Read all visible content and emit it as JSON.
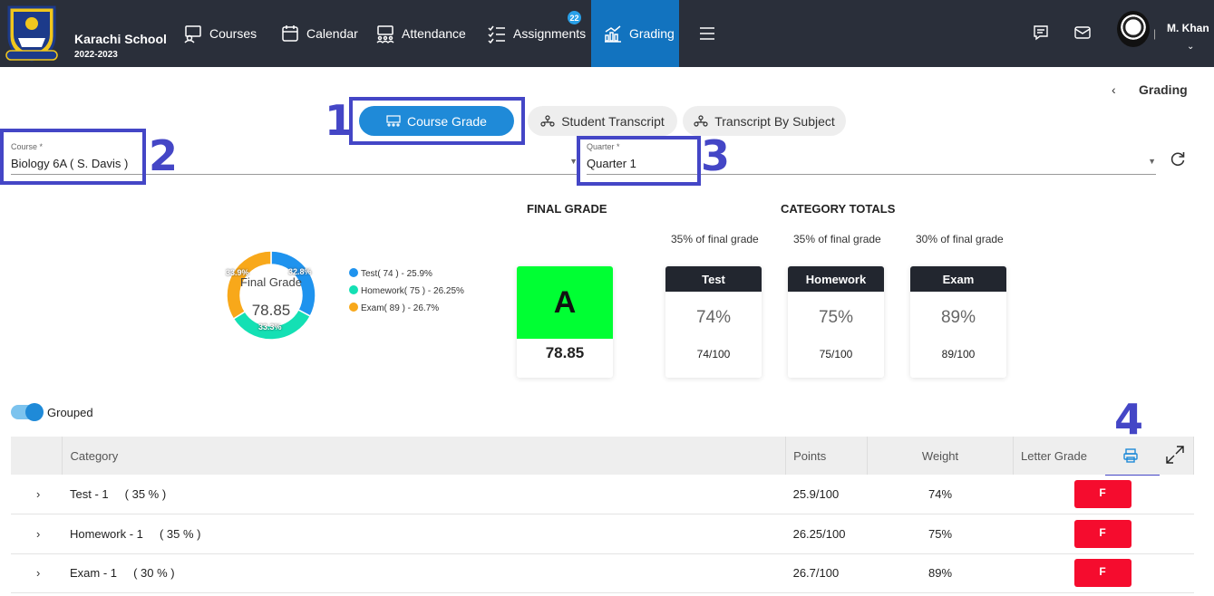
{
  "header": {
    "school_name": "Karachi School",
    "school_year": "2022-2023",
    "logo_text": "SEEK THE LIGHT",
    "nav": [
      {
        "label": "Courses",
        "icon": "courses-icon"
      },
      {
        "label": "Calendar",
        "icon": "calendar-icon"
      },
      {
        "label": "Attendance",
        "icon": "attendance-icon"
      },
      {
        "label": "Assignments",
        "icon": "assignments-icon",
        "badge": "22"
      },
      {
        "label": "Grading",
        "icon": "grading-icon",
        "active": true
      }
    ],
    "user_name": "M. Khan",
    "accent": "#1273bf",
    "bar_color": "#2a2f3a"
  },
  "breadcrumb": {
    "back": "‹",
    "title": "Grading"
  },
  "tabs": [
    {
      "label": "Course Grade",
      "active": true
    },
    {
      "label": "Student Transcript"
    },
    {
      "label": "Transcript By Subject"
    }
  ],
  "filters": {
    "course": {
      "label": "Course *",
      "value": "Biology 6A ( S. Davis  )"
    },
    "quarter": {
      "label": "Quarter *",
      "value": "Quarter 1"
    }
  },
  "annotations": [
    "1",
    "2",
    "3",
    "4"
  ],
  "donut": {
    "center_label": "Final Grade",
    "center_value": "78.85",
    "slices": [
      {
        "label": "32.8%",
        "value": 32.8,
        "color": "#1f93ee"
      },
      {
        "label": "33.3%",
        "value": 33.3,
        "color": "#14e0b4"
      },
      {
        "label": "33.9%",
        "value": 33.9,
        "color": "#f8a81a"
      }
    ],
    "legend": [
      {
        "text": "Test( 74 ) - 25.9%",
        "color": "#1f93ee"
      },
      {
        "text": "Homework( 75 ) - 26.25%",
        "color": "#14e0b4"
      },
      {
        "text": "Exam( 89 ) - 26.7%",
        "color": "#f8a81a"
      }
    ]
  },
  "final_grade": {
    "title": "FINAL GRADE",
    "letter": "A",
    "score": "78.85",
    "color": "#00ff33"
  },
  "category_totals": {
    "title": "CATEGORY TOTALS",
    "items": [
      {
        "share": "35% of final grade",
        "name": "Test",
        "pct": "74%",
        "frac": "74/100"
      },
      {
        "share": "35% of final grade",
        "name": "Homework",
        "pct": "75%",
        "frac": "75/100"
      },
      {
        "share": "30% of final grade",
        "name": "Exam",
        "pct": "89%",
        "frac": "89/100"
      }
    ]
  },
  "toggle": {
    "label": "Grouped",
    "on": true
  },
  "table": {
    "headers": {
      "category": "Category",
      "points": "Points",
      "weight": "Weight",
      "letter": "Letter Grade"
    },
    "rows": [
      {
        "category": "Test - 1",
        "share": "( 35 % )",
        "points": "25.9/100",
        "weight": "74%",
        "letter": "F"
      },
      {
        "category": "Homework - 1",
        "share": "( 35 % )",
        "points": "26.25/100",
        "weight": "75%",
        "letter": "F"
      },
      {
        "category": "Exam - 1",
        "share": "( 30 % )",
        "points": "26.7/100",
        "weight": "89%",
        "letter": "F"
      }
    ],
    "fail_color": "#f50c2e"
  }
}
